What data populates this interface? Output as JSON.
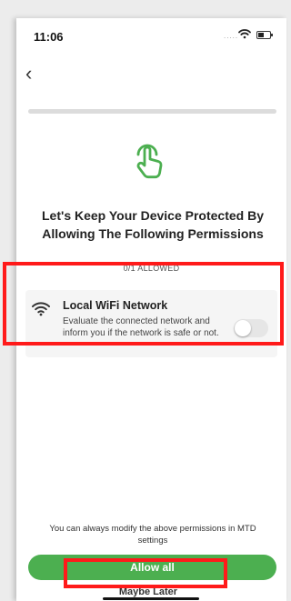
{
  "status_bar": {
    "time": "11:06",
    "signal": "....."
  },
  "navigation": {
    "back_label": "‹"
  },
  "progress": {
    "fraction": 0.0
  },
  "permissions_screen": {
    "hero_icon": "hand-tap-icon",
    "headline": "Let's Keep Your Device Protected By Allowing The Following Permissions",
    "allowed_count": "0/1 ALLOWED"
  },
  "permission_items": [
    {
      "icon": "wifi-icon",
      "title": "Local WiFi Network",
      "description": "Evaluate the connected network and inform you if the network is safe or not.",
      "enabled": false
    }
  ],
  "footer": {
    "note": "You can always modify the above permissions in MTD settings",
    "allow_all_label": "Allow all",
    "maybe_later_label": "Maybe Later"
  },
  "colors": {
    "accent": "#4caf50",
    "highlight": "#ff1a1a"
  }
}
